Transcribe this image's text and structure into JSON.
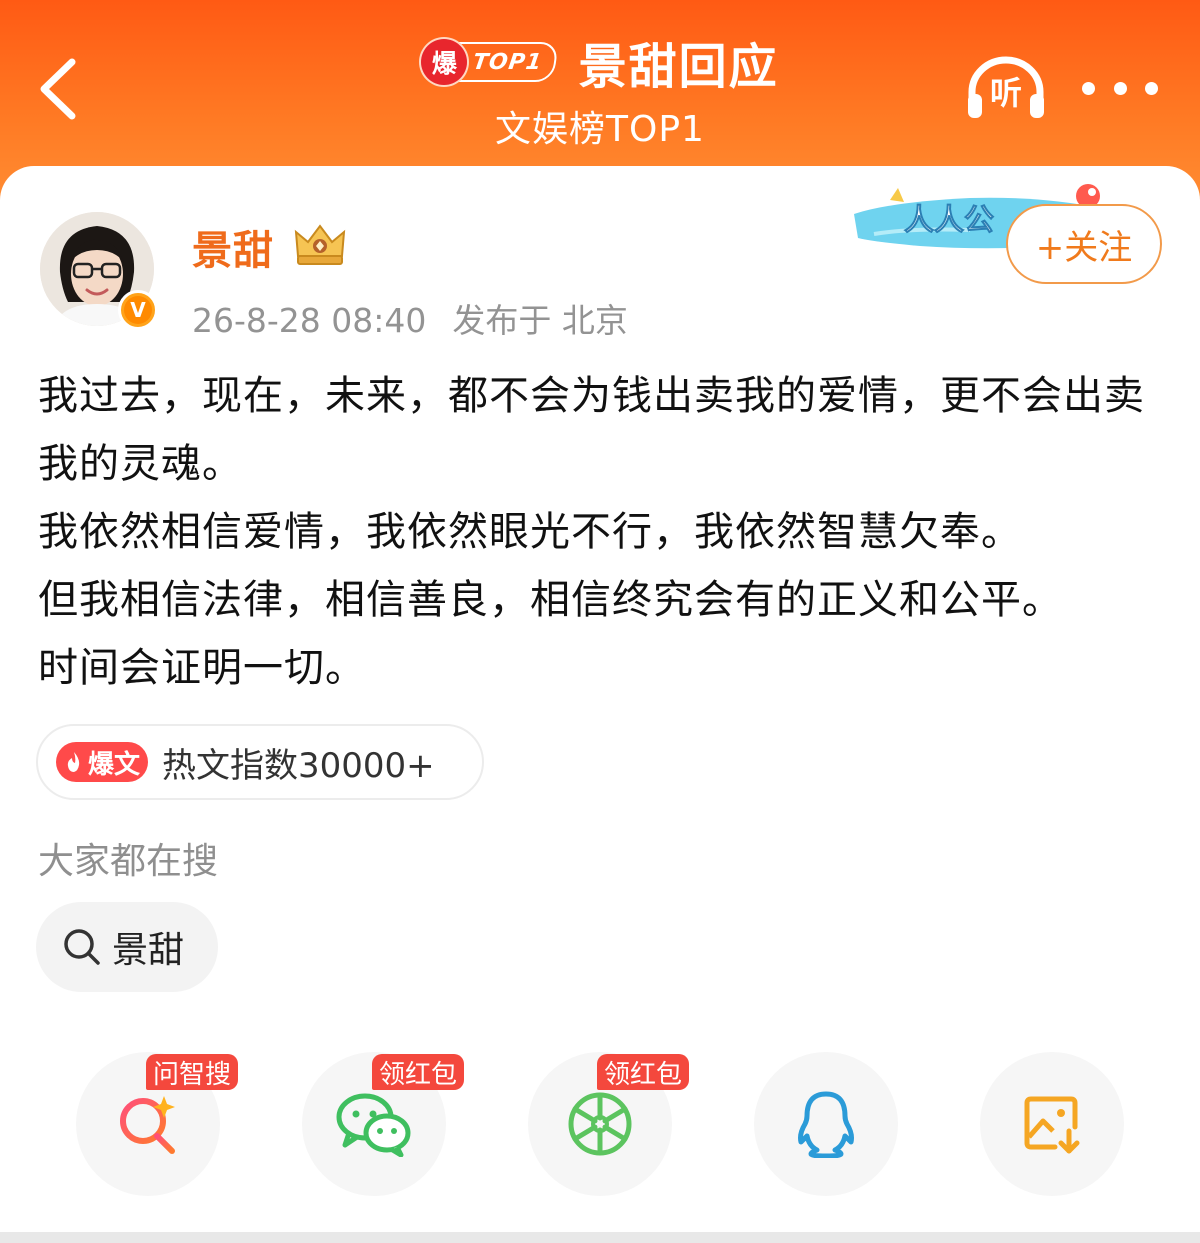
{
  "header": {
    "badge_icon_text": "爆",
    "badge_rank": "TOP1",
    "title": "景甜回应",
    "subtitle": "文娱榜TOP1",
    "listen_label": "听",
    "icons": [
      "back-arrow-icon",
      "headphones-icon",
      "more-dots-icon"
    ]
  },
  "post": {
    "author": "景甜",
    "verified_mark": "V",
    "timestamp": "26-8-28 08:40",
    "location": "发布于 北京",
    "banner_text": "人人公",
    "follow_label": "+关注",
    "lines": [
      "我过去，现在，未来，都不会为钱出卖我的爱情，更不会出卖我的灵魂。",
      "我依然相信爱情，我依然眼光不行，我依然智慧欠奉。",
      "但我相信法律，相信善良，相信终究会有的正义和公平。",
      "时间会证明一切。"
    ]
  },
  "hot": {
    "tag_label": "爆文",
    "index_text": "热文指数30000+"
  },
  "search": {
    "section_title": "大家都在搜",
    "chips": [
      {
        "label": "景甜"
      }
    ]
  },
  "share": {
    "buttons": [
      {
        "name": "ai-search",
        "tag": "问智搜",
        "icon": "ai-search-icon"
      },
      {
        "name": "wechat",
        "tag": "领红包",
        "icon": "wechat-icon"
      },
      {
        "name": "moments",
        "tag": "领红包",
        "icon": "moments-icon"
      },
      {
        "name": "qq",
        "tag": "",
        "icon": "qq-icon"
      },
      {
        "name": "save-image",
        "tag": "",
        "icon": "save-image-icon"
      }
    ]
  },
  "colors": {
    "header_orange": "#ff6a1a",
    "author_orange": "#ef6b1b",
    "tag_red": "#f4483d",
    "wechat_green": "#3fbf5f",
    "qq_blue": "#2b9bd8",
    "save_orange": "#f5a623"
  }
}
